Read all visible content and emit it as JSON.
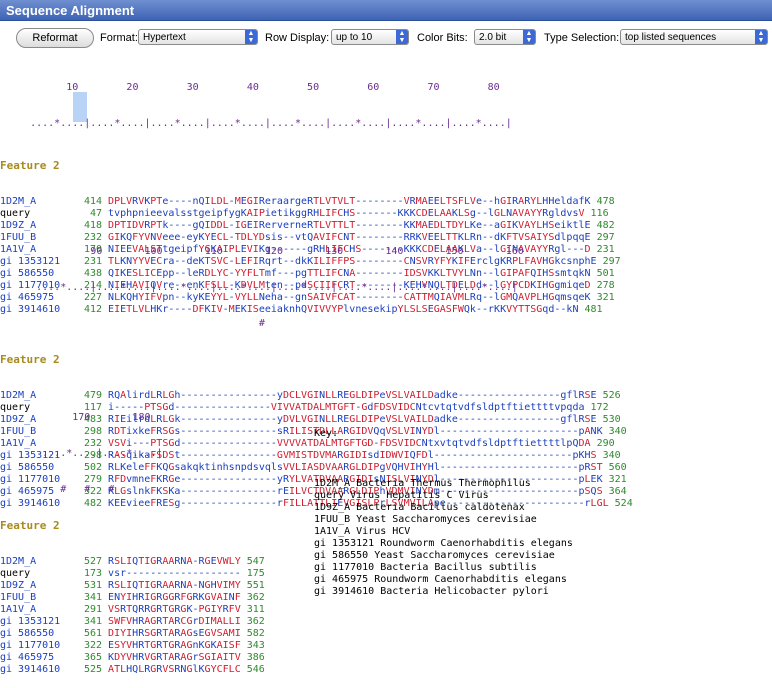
{
  "window": {
    "title": "Sequence Alignment"
  },
  "toolbar": {
    "reformat_label": "Reformat",
    "format_label": "Format:",
    "format_value": "Hypertext",
    "row_display_label": "Row Display:",
    "row_display_value": "up to 10",
    "color_bits_label": "Color Bits:",
    "color_bits_value": "2.0 bit",
    "type_selection_label": "Type Selection:",
    "type_selection_value": "top listed sequences"
  },
  "blocks": [
    {
      "ruler": "           10        20        30        40        50        60        70        80",
      "ticks": "     ....*....|....*....|....*....|....*....|....*....|....*....|....*....|....*....|",
      "hash": "",
      "feature": "Feature 2",
      "rows": [
        {
          "name": "1D2M_A",
          "start": "414",
          "seq": "DPLVRVKPTe----nQILDL-MEGIReraargeRTLVTVLT--------VRMAEELTSFLVe--hGIRARYLHHeldafK",
          "end": "478"
        },
        {
          "name": "query",
          "start": "47",
          "seq": "tvphpnieevalsstgeipfygKAIPietikggRHLIFCHS-------KKKCDELAAKLSg--lGLNAVAYYRgldvsV",
          "end": "116"
        },
        {
          "name": "1D9Z_A",
          "start": "418",
          "seq": "DPTIDVRPTk----gQIDDL-IGEIRerverneRTLVTTLT--------KKMAEDLTDYLKe--aGIKVAYLHSeiktlE",
          "end": "482"
        },
        {
          "name": "1FUU_B",
          "start": "232",
          "seq": "GIKQFYVNVeee-eyKYECL-TDLYDsis--vtQAVIFCNT--------RRKVEELTTKLRn--dKFTVSAIYSdlpqqE",
          "end": "297"
        },
        {
          "name": "1A1V_A",
          "start": "170",
          "seq": "NIEEVALSTtgeipfYGKAIPLEVIKg------gRHLIFCHS-------KKKCDELAAKLVa--lGINAVAYYRgl---D",
          "end": "231"
        },
        {
          "name": "gi 1353121",
          "start": "231",
          "seq": "TLKNYYVECra--deKTSVC-LEFIRqrt--dkKILIFFPS--------CNSVRYFYKIFErclgKRPLFAVHGkcsnphE",
          "end": "297"
        },
        {
          "name": "gi 586550",
          "start": "438",
          "seq": "QIKESLICEpp--leRDLYC-YYFLTmf---pgTTLIFCNA--------IDSVKKLTVYLNn--lGIPAFQIHSsmtqkN",
          "end": "501"
        },
        {
          "name": "gi 1177010",
          "start": "214",
          "seq": "NIEHAVIQVre--enKFSLL-KDVLMten--pdSCIIFCRT--------KEHVNQLTDELDd--lGYPCDKIHGgmiqeD",
          "end": "278"
        },
        {
          "name": "gi 465975",
          "start": "227",
          "seq": "NLKQHYIFVpn--kyKEYYL-VYLLNeha--gnSAIVFCAT--------CATTMQIAVMLRq--lGMQAVPLHGqmsqeK",
          "end": "321"
        },
        {
          "name": "gi 3914610",
          "start": "412",
          "seq": "EIETLVLHKr----DFKIV-MEKISeeiaknhQVIVVYPlvnesekipYLSLSEGASFWQk--rKKVYTTSGqd--kN",
          "end": "481"
        }
      ]
    },
    {
      "ruler": "               90       100       110       120       130       140       150       160",
      "ticks": "      ....*....|....*....|....*....|....*....|....*....|....*....|....*....|....*....|",
      "hash": "                                           #",
      "feature": "Feature 2",
      "rows": [
        {
          "name": "1D2M_A",
          "start": "479",
          "seq": "RQAlirdLRLGh----------------yDCLVGINLLREGLDIPeVSLVAILDadke-----------------gflRSE",
          "end": "526"
        },
        {
          "name": "query",
          "start": "117",
          "seq": "i-----PTSGd----------------VIVVATDALMTGFT-GdFDSVIDCNtcvtqtvdfsldptftiettttvpqda",
          "end": "172"
        },
        {
          "name": "1D9Z_A",
          "start": "483",
          "seq": "RIEilrdLRLGk----------------yDVLVGINLLREGLDIPeVSLVAILDadke-----------------gflRSE",
          "end": "530"
        },
        {
          "name": "1FUU_B",
          "start": "298",
          "seq": "RDTixkeFRSGs----------------sRILISTDLLARGIDVQqVSLVINYDl-----------------------pANK",
          "end": "340"
        },
        {
          "name": "1A1V_A",
          "start": "232",
          "seq": "VSVi---PTSGd----------------VVVVATDALMTGFTGD-FDSVIDCNtxvtqtvdfsldptftiettttlpQDA",
          "end": "290"
        },
        {
          "name": "gi 1353121",
          "start": "298",
          "seq": "RASqikaFSDSt----------------GVMISTDVMARGIDIsdIDWVIQFDl-----------------------pKHS",
          "end": "340"
        },
        {
          "name": "gi 586550",
          "start": "502",
          "seq": "RLKeleFFKQGsakqktinhsnpdsvqlsVVLIASDVAARGLDIPgVQHVIHYHl-----------------------pRST",
          "end": "560"
        },
        {
          "name": "gi 1177010",
          "start": "279",
          "seq": "RFDvmneFKRGe----------------yRYLVATDVAARGIDIsNISLVINYDl-----------------------pLEK",
          "end": "321"
        },
        {
          "name": "gi 465975",
          "start": "322",
          "seq": "RLGslnkFKSKa----------------rEILVCTDVAARGLDIPhVDMVINYDm-----------------------pSQS",
          "end": "364"
        },
        {
          "name": "gi 3914610",
          "start": "482",
          "seq": "KEEvieeFRESg----------------rFILLATTLIEVGISLPrLSVMVILApe-----------------------rLGL",
          "end": "524"
        }
      ]
    },
    {
      "ruler": "            170       180",
      "ticks": "       ....*....|....*....|",
      "hash": "          #   #   #",
      "feature": "Feature 2",
      "rows": [
        {
          "name": "1D2M_A",
          "start": "527",
          "seq": "RSLIQTIGRAARNA-RGEVWLY",
          "end": "547"
        },
        {
          "name": "query",
          "start": "173",
          "seq": "vsr-------------------",
          "end": "175"
        },
        {
          "name": "1D9Z_A",
          "start": "531",
          "seq": "RSLIQTIGRAARNA-NGHVIMY",
          "end": "551"
        },
        {
          "name": "1FUU_B",
          "start": "341",
          "seq": "ENYIHRIGRGGRFGRKGVAINF",
          "end": "362"
        },
        {
          "name": "1A1V_A",
          "start": "291",
          "seq": "VSRTQRRGRTGRGK-PGIYRFV",
          "end": "311"
        },
        {
          "name": "gi 1353121",
          "start": "341",
          "seq": "SWFVHRAGRTARCGrDIMALLI",
          "end": "362"
        },
        {
          "name": "gi 586550",
          "start": "561",
          "seq": "DIYIHRSGRTARAGsEGVSAMI",
          "end": "582"
        },
        {
          "name": "gi 1177010",
          "start": "322",
          "seq": "ESYVHRTGRTGRAGnKGKAISF",
          "end": "343"
        },
        {
          "name": "gi 465975",
          "start": "365",
          "seq": "KDYVHRVGRTARAGrSGIAITV",
          "end": "386"
        },
        {
          "name": "gi 3914610",
          "start": "525",
          "seq": "ATLHQLRGRVSRNGlKGYCFLC",
          "end": "546"
        }
      ]
    }
  ],
  "key": {
    "title": "Key:",
    "entries": [
      "1D2M_A Bacteria Thermus Thermophilus",
      "query Virus Hepatitis C Virus",
      "1D9Z_A Bacteria Bacillus caldotenax",
      "1FUU_B Yeast Saccharomyces cerevisiae",
      "1A1V_A Virus HCV",
      "gi 1353121 Roundworm Caenorhabditis elegans",
      "gi 586550 Yeast Saccharomyces cerevisiae",
      "gi 1177010 Bacteria Bacillus subtilis",
      "gi 465975 Roundworm Caenorhabditis elegans",
      "gi 3914610 Bacteria Helicobacter pylori"
    ]
  }
}
